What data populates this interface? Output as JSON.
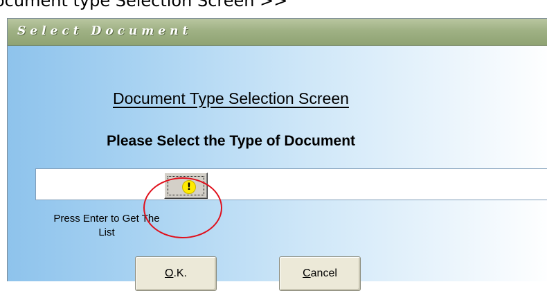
{
  "caption": "ocument type Selection Screen >>",
  "window": {
    "title": "Select Document"
  },
  "main": {
    "heading": "Document Type Selection Screen",
    "subheading": "Please Select the Type of Document",
    "document_type_input": {
      "value": "",
      "placeholder": ""
    },
    "lookup_button": {
      "icon": "exclamation-icon",
      "glyph": "!"
    },
    "hint_line1": "Press Enter to Get The",
    "hint_line2": "List",
    "ok_button": {
      "mnemonic": "O",
      "rest": ".K."
    },
    "cancel_button": {
      "mnemonic": "C",
      "rest": "ancel"
    }
  },
  "annotation": {
    "circle_color": "#e0101c"
  }
}
